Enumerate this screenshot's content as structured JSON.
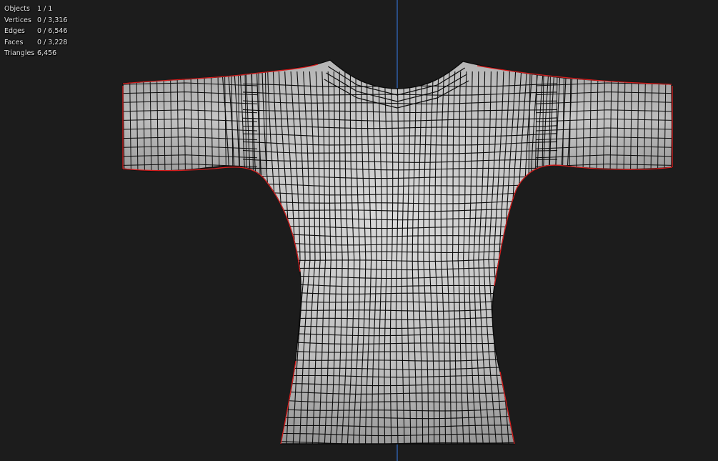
{
  "stats": [
    {
      "label": "Objects",
      "value": "1 / 1"
    },
    {
      "label": "Vertices",
      "value": "0 / 3,316"
    },
    {
      "label": "Edges",
      "value": "0 / 6,546"
    },
    {
      "label": "Faces",
      "value": "0 / 3,228"
    },
    {
      "label": "Triangles",
      "value": "6,456"
    }
  ],
  "colors": {
    "background": "#1c1c1c",
    "grid": "#222222",
    "z_axis": "#2d5a9e",
    "mesh_fill": "#c9c9c9",
    "wire": "#0a0a0a",
    "seam": "#d61e1e"
  }
}
